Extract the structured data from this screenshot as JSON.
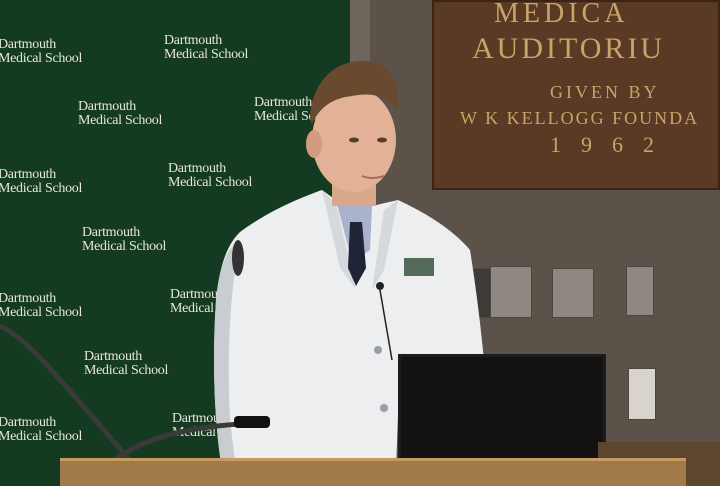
{
  "backdrop": {
    "logo_line1": "Dartmouth",
    "logo_line2": "Medical School"
  },
  "plaque": {
    "line1": "MEDICA",
    "line2": "AUDITORIU",
    "line3": "GIVEN BY",
    "line4": "W K KELLOGG FOUNDA",
    "line5": "1962"
  },
  "colors": {
    "backdrop": "#153a22",
    "logo_text": "#e7e6dc",
    "plaque": "#5a3a24",
    "plaque_text": "#c9a36a",
    "coat": "#eceef0"
  }
}
